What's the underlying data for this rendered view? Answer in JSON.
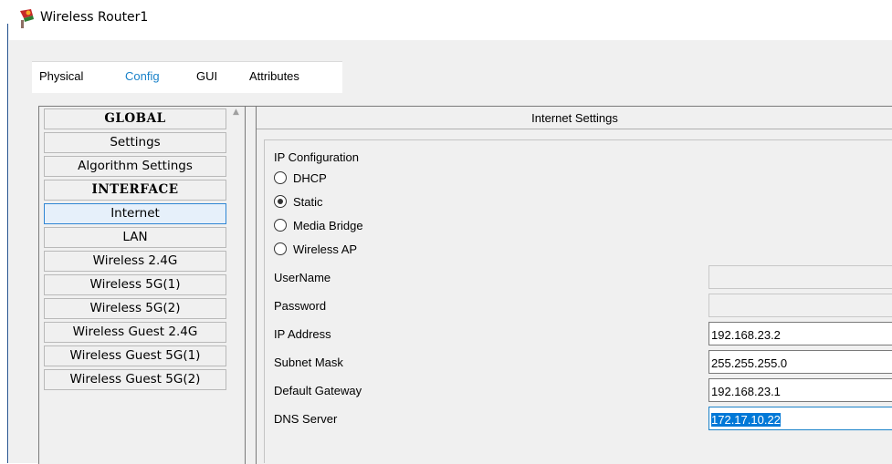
{
  "window": {
    "title": "Wireless Router1",
    "icon": "router-icon"
  },
  "tabs": [
    {
      "label": "Physical",
      "active": false
    },
    {
      "label": "Config",
      "active": true
    },
    {
      "label": "GUI",
      "active": false
    },
    {
      "label": "Attributes",
      "active": false
    }
  ],
  "sidebar": {
    "items": [
      {
        "label": "GLOBAL",
        "type": "header"
      },
      {
        "label": "Settings",
        "type": "item"
      },
      {
        "label": "Algorithm Settings",
        "type": "item"
      },
      {
        "label": "INTERFACE",
        "type": "header"
      },
      {
        "label": "Internet",
        "type": "item",
        "selected": true
      },
      {
        "label": "LAN",
        "type": "item"
      },
      {
        "label": "Wireless 2.4G",
        "type": "item"
      },
      {
        "label": "Wireless 5G(1)",
        "type": "item"
      },
      {
        "label": "Wireless 5G(2)",
        "type": "item"
      },
      {
        "label": "Wireless Guest 2.4G",
        "type": "item"
      },
      {
        "label": "Wireless Guest 5G(1)",
        "type": "item"
      },
      {
        "label": "Wireless Guest 5G(2)",
        "type": "item"
      }
    ]
  },
  "panel": {
    "title": "Internet Settings",
    "ip_config_label": "IP Configuration",
    "options": [
      {
        "label": "DHCP",
        "checked": false
      },
      {
        "label": "Static",
        "checked": true
      },
      {
        "label": "Media Bridge",
        "checked": false
      },
      {
        "label": "Wireless AP",
        "checked": false
      }
    ],
    "fields": {
      "username": {
        "label": "UserName",
        "value": ""
      },
      "password": {
        "label": "Password",
        "value": ""
      },
      "ip_address": {
        "label": "IP Address",
        "value": "192.168.23.2"
      },
      "subnet_mask": {
        "label": "Subnet Mask",
        "value": "255.255.255.0"
      },
      "default_gateway": {
        "label": "Default Gateway",
        "value": "192.168.23.1"
      },
      "dns_server": {
        "label": "DNS Server",
        "value": "172.17.10.22"
      }
    }
  }
}
